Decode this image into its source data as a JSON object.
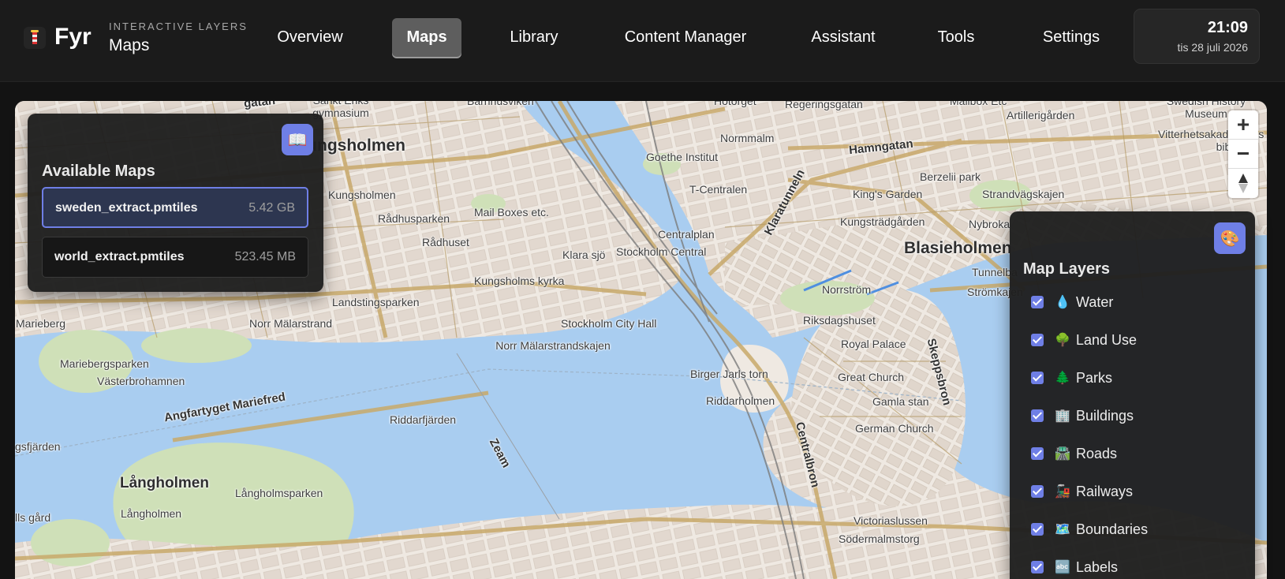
{
  "header": {
    "brand": "Fyr",
    "subtitle_top": "INTERACTIVE LAYERS",
    "subtitle_main": "Maps",
    "nav": [
      {
        "label": "Overview",
        "active": false
      },
      {
        "label": "Maps",
        "active": true
      },
      {
        "label": "Library",
        "active": false
      },
      {
        "label": "Content Manager",
        "active": false
      },
      {
        "label": "Assistant",
        "active": false
      },
      {
        "label": "Tools",
        "active": false
      },
      {
        "label": "Settings",
        "active": false
      }
    ],
    "clock": {
      "time": "21:09",
      "date": "tis 28 juli 2026"
    }
  },
  "maps_panel": {
    "title": "Available Maps",
    "icon": "map-book-icon",
    "files": [
      {
        "name": "sweden_extract.pmtiles",
        "size": "5.42 GB",
        "selected": true
      },
      {
        "name": "world_extract.pmtiles",
        "size": "523.45 MB",
        "selected": false
      }
    ]
  },
  "layers_panel": {
    "title": "Map Layers",
    "icon": "palette-icon",
    "layers": [
      {
        "emoji": "💧",
        "label": "Water",
        "checked": true
      },
      {
        "emoji": "🌳",
        "label": "Land Use",
        "checked": true
      },
      {
        "emoji": "🌲",
        "label": "Parks",
        "checked": true
      },
      {
        "emoji": "🏢",
        "label": "Buildings",
        "checked": true
      },
      {
        "emoji": "🛣️",
        "label": "Roads",
        "checked": true
      },
      {
        "emoji": "🚂",
        "label": "Railways",
        "checked": true
      },
      {
        "emoji": "🗺️",
        "label": "Boundaries",
        "checked": true
      },
      {
        "emoji": "🔤",
        "label": "Labels",
        "checked": true
      }
    ]
  },
  "map_controls": {
    "zoom_in": "+",
    "zoom_out": "−"
  },
  "map_labels": [
    "Kungsholmen",
    "Blasieholmen",
    "Långholmen",
    "Hamngatan",
    "Klaratunneln",
    "Skeppsbron",
    "Centralbron",
    "Angfartyget Mariefred",
    "Zeam",
    "Barnhusviken",
    "Hötorget",
    "Regeringsgatan",
    "Mailbox Etc",
    "Swedish History Museum",
    "Artillerigården",
    "Vitterhetsakademiens bibliotek",
    "Normmalm",
    "Goethe Institut",
    "Berzelii park",
    "Strandvägskajen",
    "T-Centralen",
    "King's Garden",
    "Kungsträdgården",
    "Nybroka",
    "Tunnelba",
    "Strömkajen",
    "Centralplan",
    "Stockholm Central",
    "Klara sjö",
    "Mail Boxes etc.",
    "Rådhusparken",
    "Rådhuset",
    "Kungsholmen",
    "Kungsholms kyrka",
    "Landstingsparken",
    "Norr Mälarstrand",
    "Stockholm City Hall",
    "Norrström",
    "Riksdagshuset",
    "Royal Palace",
    "Great Church",
    "Gamla stan",
    "German Church",
    "Birger Jarls torn",
    "Riddarholmen",
    "Norr Mälarstrandskajen",
    "Riddarfjärden",
    "Marieberg",
    "Mariebergsparken",
    "Västerbrohamnen",
    "gsfjärden",
    "Långholmsparken",
    "Långholmen",
    "lls gård",
    "Victoriaslussen",
    "Södermalmstorg",
    "gatan",
    "Sankt Eriks gymnasium"
  ]
}
